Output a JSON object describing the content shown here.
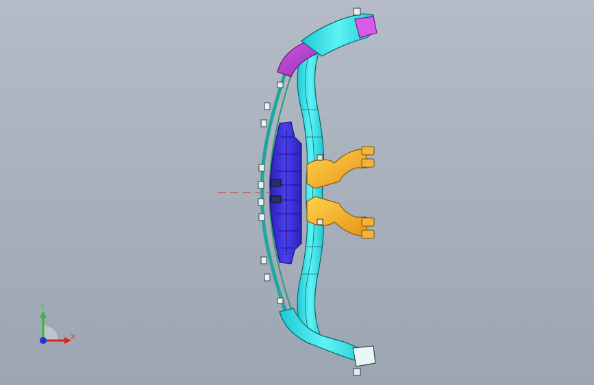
{
  "viewport": {
    "background_top": "#b5bcc7",
    "background_bottom": "#9ca5b2"
  },
  "model": {
    "parts": [
      {
        "name": "upper-arm-duct",
        "color": "#33e6e6"
      },
      {
        "name": "upper-transition",
        "color": "#c740d9"
      },
      {
        "name": "lower-arm-duct",
        "color": "#33e6e6"
      },
      {
        "name": "center-housing",
        "color": "#3a2fd6"
      },
      {
        "name": "outlet-branch-upper",
        "color": "#f5a623"
      },
      {
        "name": "outlet-branch-lower",
        "color": "#f5a623"
      },
      {
        "name": "front-rail",
        "color": "#1fa89a"
      }
    ],
    "centerline_color": "#c0392b"
  },
  "triad": {
    "x_label": "X",
    "y_label": "Y",
    "x_color": "#dd2222",
    "y_color": "#33bb33",
    "z_color": "#2233dd"
  }
}
